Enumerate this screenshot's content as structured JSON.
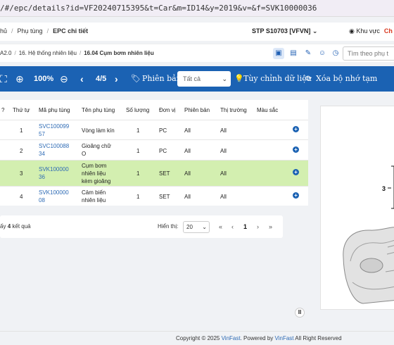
{
  "browser": {
    "url": "/#/epc/details?id=VF20240715395&t=Car&m=ID14&y=2019&v=&f=SVK10000036"
  },
  "topnav": {
    "crumbs": [
      "hủ",
      "Phụ tùng",
      "EPC chi tiết"
    ],
    "stp": "STP S10703 [VFVN]",
    "stp_caret": "⌄",
    "region": "Khu vực",
    "lang": "Ch"
  },
  "subnav": {
    "crumbs": [
      "A2.0",
      "16. Hệ thống nhiên liệu",
      "16.04 Cụm bơm nhiên liệu"
    ],
    "search_placeholder": "Tìm theo phụ t"
  },
  "toolbar": {
    "zoom": "100%",
    "page": "4/5",
    "version_label": "Phiên bản",
    "version_select": "Tất cả",
    "custom_label": "Tùy chỉnh dữ liệu",
    "clear_cache_label": "Xóa bộ nhớ tạm"
  },
  "table": {
    "headers": [
      "?",
      "Thứ tự",
      "Mã phụ tùng",
      "Tên phụ tùng",
      "Số lượng",
      "Đơn vị",
      "Phiên bản",
      "Thị trường",
      "Màu sắc"
    ],
    "rows": [
      {
        "order": "1",
        "code1": "SVC100099",
        "code2": "57",
        "name1": "Vòng làm kín",
        "name2": "",
        "name3": "",
        "qty": "1",
        "unit": "PC",
        "version": "All",
        "market": "All",
        "color": ""
      },
      {
        "order": "2",
        "code1": "SVC100088",
        "code2": "34",
        "name1": "Gioăng chữ",
        "name2": "O",
        "name3": "",
        "qty": "1",
        "unit": "PC",
        "version": "All",
        "market": "All",
        "color": ""
      },
      {
        "order": "3",
        "code1": "SVK100000",
        "code2": "36",
        "name1": "Cụm bơm",
        "name2": "nhiên liệu",
        "name3": "kèm gioăng",
        "qty": "1",
        "unit": "SET",
        "version": "All",
        "market": "All",
        "color": ""
      },
      {
        "order": "4",
        "code1": "SVK100000",
        "code2": "08",
        "name1": "Cảm biến",
        "name2": "nhiên liệu",
        "name3": "",
        "qty": "1",
        "unit": "SET",
        "version": "All",
        "market": "All",
        "color": ""
      }
    ]
  },
  "pagination": {
    "summary_pre": "ấy",
    "summary_count": "4",
    "summary_post": "kết quả",
    "show_label": "Hiển thị:",
    "page_size": "20",
    "first": "«",
    "prev": "‹",
    "current": "1",
    "next": "›",
    "last": "»"
  },
  "diagram": {
    "callout": "3"
  },
  "footer": {
    "pre": "Copyright © 2025",
    "brand1": "VinFast",
    "mid": ". Powered by",
    "brand2": "VinFast",
    "post": "All Right Reserved"
  },
  "colors": {
    "toolbar": "#1b62b3",
    "highlight_row": "#d3efb0",
    "link": "#2e6bb5",
    "accent_red": "#d9381e"
  }
}
